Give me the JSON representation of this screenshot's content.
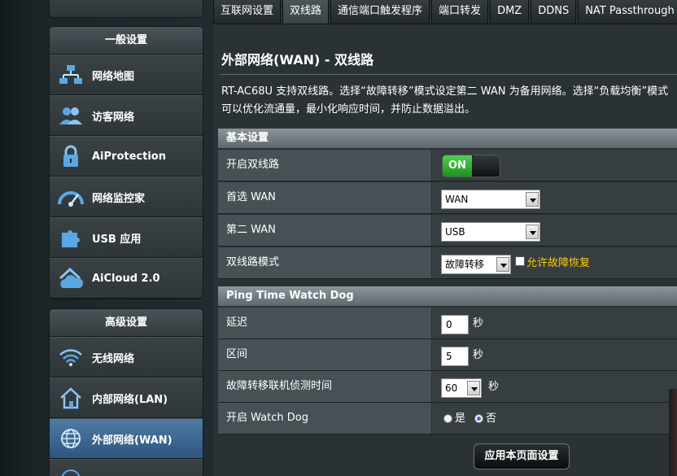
{
  "sidebar": {
    "general_header": "一般设置",
    "general_items": [
      {
        "label": "网络地图",
        "icon": "network-map-icon"
      },
      {
        "label": "访客网络",
        "icon": "guest-network-icon"
      },
      {
        "label": "AiProtection",
        "icon": "lock-icon"
      },
      {
        "label": "网络监控家",
        "icon": "gauge-icon"
      },
      {
        "label": "USB 应用",
        "icon": "puzzle-icon"
      },
      {
        "label": "AiCloud 2.0",
        "icon": "cloud-house-icon"
      }
    ],
    "advanced_header": "高级设置",
    "advanced_items": [
      {
        "label": "无线网络",
        "icon": "wifi-icon"
      },
      {
        "label": "内部网络(LAN)",
        "icon": "home-icon"
      },
      {
        "label": "外部网络(WAN)",
        "icon": "globe-icon"
      }
    ]
  },
  "tabs": [
    {
      "label": "互联网设置",
      "active": false
    },
    {
      "label": "双线路",
      "active": true
    },
    {
      "label": "通信端口触发程序",
      "active": false
    },
    {
      "label": "端口转发",
      "active": false
    },
    {
      "label": "DMZ",
      "active": false
    },
    {
      "label": "DDNS",
      "active": false
    },
    {
      "label": "NAT Passthrough",
      "active": false
    }
  ],
  "page": {
    "title": "外部网络(WAN) - 双线路",
    "description": "RT-AC68U 支持双线路。选择“故障转移”模式设定第二 WAN 为备用网络。选择“负载均衡”模式可以优化流通量，最小化响应时间，并防止数据溢出。"
  },
  "basic": {
    "header": "基本设置",
    "enable_dual_wan_label": "开启双线路",
    "toggle_text": "ON",
    "primary_wan_label": "首选 WAN",
    "primary_wan_value": "WAN",
    "secondary_wan_label": "第二 WAN",
    "secondary_wan_value": "USB",
    "mode_label": "双线路模式",
    "mode_value": "故障转移",
    "failback_label": "允许故障恢复"
  },
  "watchdog": {
    "header": "Ping Time Watch Dog",
    "delay_label": "延迟",
    "delay_value": "0",
    "delay_unit": "秒",
    "interval_label": "区间",
    "interval_value": "5",
    "interval_unit": "秒",
    "detect_label": "故障转移联机侦测时间",
    "detect_value": "60",
    "detect_unit": "秒",
    "enable_label": "开启 Watch Dog",
    "yes_label": "是",
    "no_label": "否",
    "selected": "否"
  },
  "apply_button": "应用本页面设置",
  "colors": {
    "accent_active": "#3d6a96",
    "toggle_on": "#2eaa2e",
    "failback_text": "#ffcc00"
  }
}
